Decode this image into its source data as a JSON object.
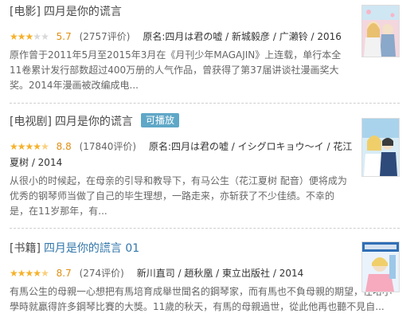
{
  "results": [
    {
      "category": "[电影]",
      "title": "四月是你的谎言",
      "rating_stars": 3,
      "score": "5.7",
      "ratings_count": "(2757评价)",
      "subtitle": "原名:四月は君の嘘 / 新城毅彦 / 广濑铃 / 2016",
      "description": "原作曾于2011年5月至2015年3月在《月刊少年MAGAJIN》上连载，单行本全11卷累计发行部数超过400万册的人气作品，曾获得了第37届讲谈社漫画奖大奖。2014年漫画被改编成电..."
    },
    {
      "category": "[电视剧]",
      "title": "四月是你的谎言",
      "badge": "可播放",
      "rating_stars": 4.5,
      "score": "8.8",
      "ratings_count": "(17840评价)",
      "subtitle": "原名:四月は君の嘘 / イシグロキョウ〜イ / 花江夏树 / 2014",
      "description": "从很小的时候起，在母亲的引导和教导下，有马公生（花江夏树 配音）便将成为优秀的钢琴师当做了自己的毕生理想，一路走来，亦斩获了不少佳绩。不幸的是，在11岁那年，有..."
    },
    {
      "category": "[书籍]",
      "title": "四月是你的謊言 01",
      "rating_stars": 4.5,
      "score": "8.7",
      "ratings_count": "(274评价)",
      "subtitle": "新川直司 / 趙秋凰 / 東立出版社 / 2014",
      "description": "有馬公生的母親一心想把有馬培育成舉世聞名的鋼琴家，而有馬也不負母親的期望，在哈小學時就贏得許多鋼琴比賽的大獎。11歲的秋天，有馬的母親過世，從此他再也聽不見自..."
    }
  ],
  "colors": {
    "link": "#3377aa",
    "star": "#f6b12b",
    "score": "#e09015",
    "badge_bg": "#5fa7c7"
  },
  "icons": [
    "star-icon",
    "half-star-icon",
    "empty-star-icon",
    "cover-thumbnail"
  ]
}
